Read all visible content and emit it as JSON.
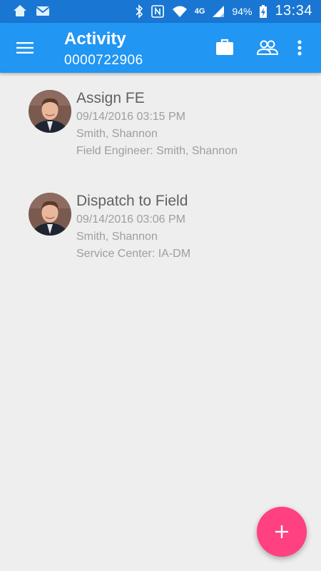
{
  "status_bar": {
    "time": "13:34",
    "battery": "94%",
    "network": "4G",
    "icons": [
      "home-icon",
      "mail-icon",
      "bluetooth-icon",
      "nfc-icon",
      "wifi-icon",
      "signal-icon",
      "battery-icon"
    ]
  },
  "app_bar": {
    "title": "Activity",
    "subtitle": "0000722906",
    "color": "#2196f3",
    "icons": [
      "menu-icon",
      "briefcase-icon",
      "people-icon",
      "more-vert-icon"
    ]
  },
  "activities": [
    {
      "title": "Assign FE",
      "datetime": "09/14/2016 03:15 PM",
      "person": "Smith, Shannon",
      "detail": "Field Engineer: Smith, Shannon"
    },
    {
      "title": "Dispatch to Field",
      "datetime": "09/14/2016 03:06 PM",
      "person": "Smith, Shannon",
      "detail": "Service Center: IA-DM"
    }
  ],
  "fab": {
    "label": "+",
    "color": "#ff4081"
  }
}
